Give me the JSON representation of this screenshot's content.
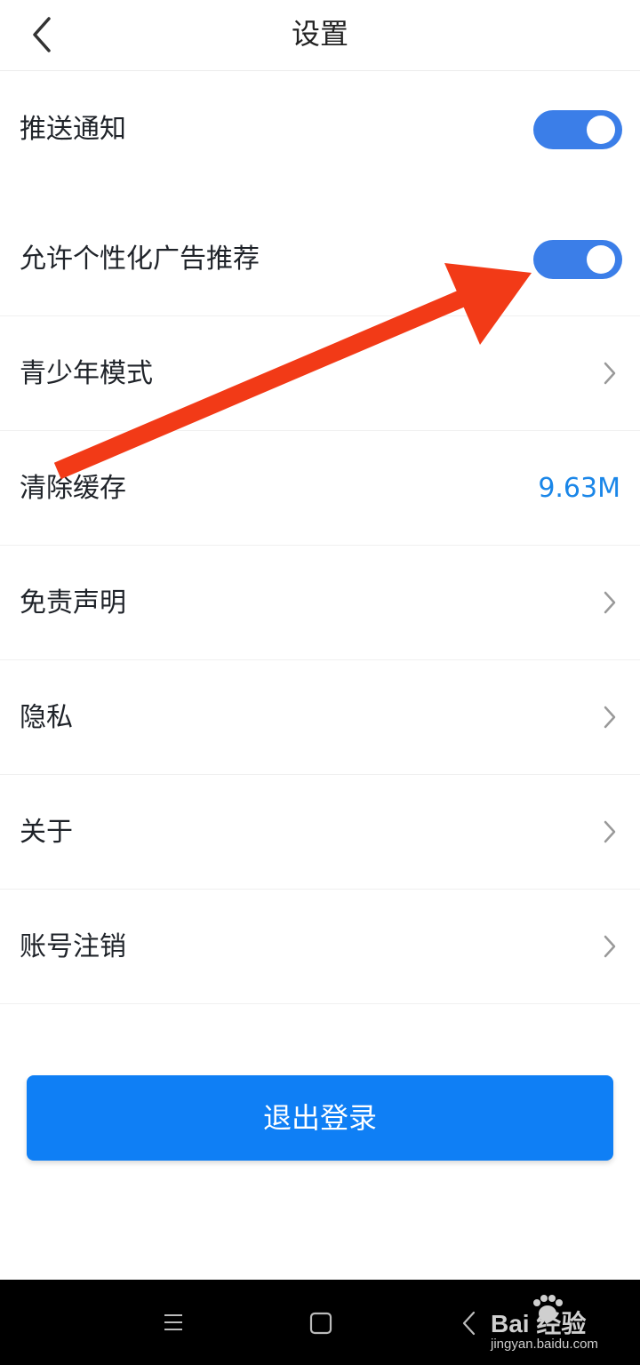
{
  "header": {
    "title": "设置"
  },
  "settings": {
    "push": {
      "label": "推送通知",
      "enabled": true
    },
    "ads": {
      "label": "允许个性化广告推荐",
      "enabled": true
    },
    "teen": {
      "label": "青少年模式"
    },
    "cache": {
      "label": "清除缓存",
      "value": "9.63M"
    },
    "disclaimer": {
      "label": "免责声明"
    },
    "privacy": {
      "label": "隐私"
    },
    "about": {
      "label": "关于"
    },
    "cancel_account": {
      "label": "账号注销"
    }
  },
  "logout_button": {
    "label": "退出登录"
  },
  "watermark": {
    "brand": "Bai  经验",
    "url": "jingyan.baidu.com"
  },
  "colors": {
    "toggle_on": "#3b7ee8",
    "button_primary": "#0f7ff5",
    "value_text": "#1a86e8",
    "annotation_arrow": "#f23a17"
  }
}
